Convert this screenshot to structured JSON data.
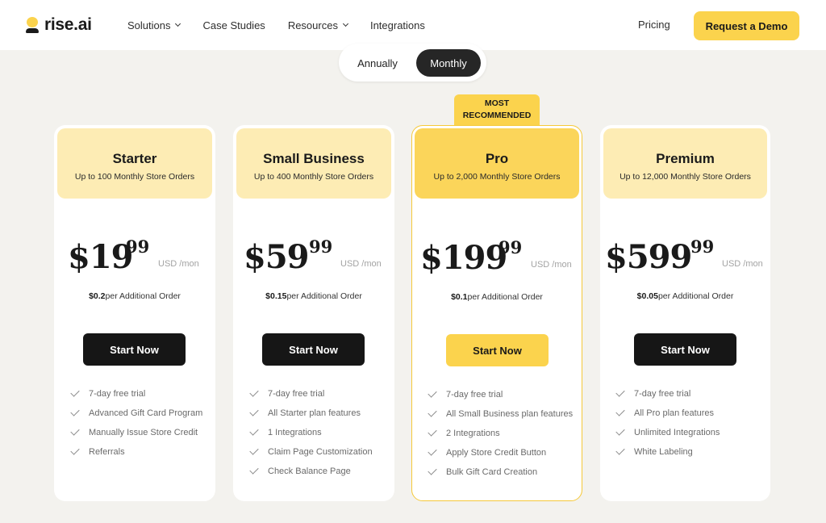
{
  "brand": {
    "name": "rise.ai",
    "logo_icon": "rise-logo-icon"
  },
  "nav": {
    "items": [
      {
        "label": "Solutions",
        "dropdown": true
      },
      {
        "label": "Case Studies",
        "dropdown": false
      },
      {
        "label": "Resources",
        "dropdown": true
      },
      {
        "label": "Integrations",
        "dropdown": false
      }
    ],
    "pricing_label": "Pricing",
    "demo_label": "Request a Demo"
  },
  "billing": {
    "annually_label": "Annually",
    "monthly_label": "Monthly",
    "selected": "Monthly"
  },
  "recommended_tag": {
    "line1": "MOST",
    "line2": "RECOMMENDED"
  },
  "colors": {
    "accent": "#fbd34d",
    "accent_light": "#fdecb4",
    "dark": "#161616",
    "background": "#f3f2ee"
  },
  "plans": [
    {
      "name": "Starter",
      "subtitle": "Up to 100 Monthly Store Orders",
      "price": "$19",
      "cents": "99",
      "unit": "USD /mon",
      "per_order_amount": "$0.2",
      "per_order_text": "per Additional Order",
      "cta": "Start Now",
      "featured": false,
      "features": [
        "7-day free trial",
        "Advanced Gift Card Program",
        "Manually Issue Store Credit",
        "Referrals"
      ]
    },
    {
      "name": "Small Business",
      "subtitle": "Up to 400 Monthly Store Orders",
      "price": "$59",
      "cents": "99",
      "unit": "USD /mon",
      "per_order_amount": "$0.15",
      "per_order_text": "per Additional Order",
      "cta": "Start Now",
      "featured": false,
      "features": [
        "7-day free trial",
        "All Starter plan features",
        "1 Integrations",
        "Claim Page Customization",
        "Check Balance Page"
      ]
    },
    {
      "name": "Pro",
      "subtitle": "Up to 2,000 Monthly Store Orders",
      "price": "$199",
      "cents": "99",
      "unit": "USD /mon",
      "per_order_amount": "$0.1",
      "per_order_text": "per Additional Order",
      "cta": "Start Now",
      "featured": true,
      "features": [
        "7-day free trial",
        "All Small Business plan features",
        "2 Integrations",
        "Apply Store Credit Button",
        "Bulk Gift Card Creation"
      ]
    },
    {
      "name": "Premium",
      "subtitle": "Up to 12,000 Monthly Store Orders",
      "price": "$599",
      "cents": "99",
      "unit": "USD /mon",
      "per_order_amount": "$0.05",
      "per_order_text": "per Additional Order",
      "cta": "Start Now",
      "featured": false,
      "features": [
        "7-day free trial",
        "All Pro plan features",
        "Unlimited Integrations",
        "White Labeling"
      ]
    }
  ]
}
